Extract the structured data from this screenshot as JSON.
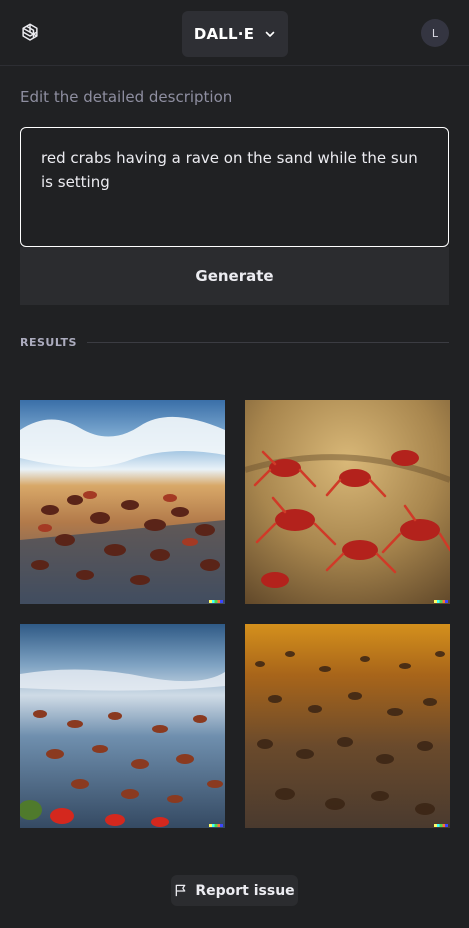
{
  "header": {
    "model_label": "DALL·E",
    "avatar_initial": "L"
  },
  "editor": {
    "label": "Edit the detailed description",
    "prompt_text": "red crabs having a rave on the sand while the sun is setting",
    "generate_label": "Generate"
  },
  "results": {
    "label": "RESULTS",
    "images": [
      {
        "icon": "crabs-on-shore-with-waves-image"
      },
      {
        "icon": "red-crabs-on-sand-closeup-image"
      },
      {
        "icon": "crabs-on-wet-shore-image"
      },
      {
        "icon": "crabs-at-sunset-sand-image"
      }
    ]
  },
  "footer": {
    "report_label": "Report issue"
  },
  "colors": {
    "background": "#202123",
    "button": "#2b2c2f",
    "text": "#ececf1",
    "muted": "#8e8ea0"
  }
}
